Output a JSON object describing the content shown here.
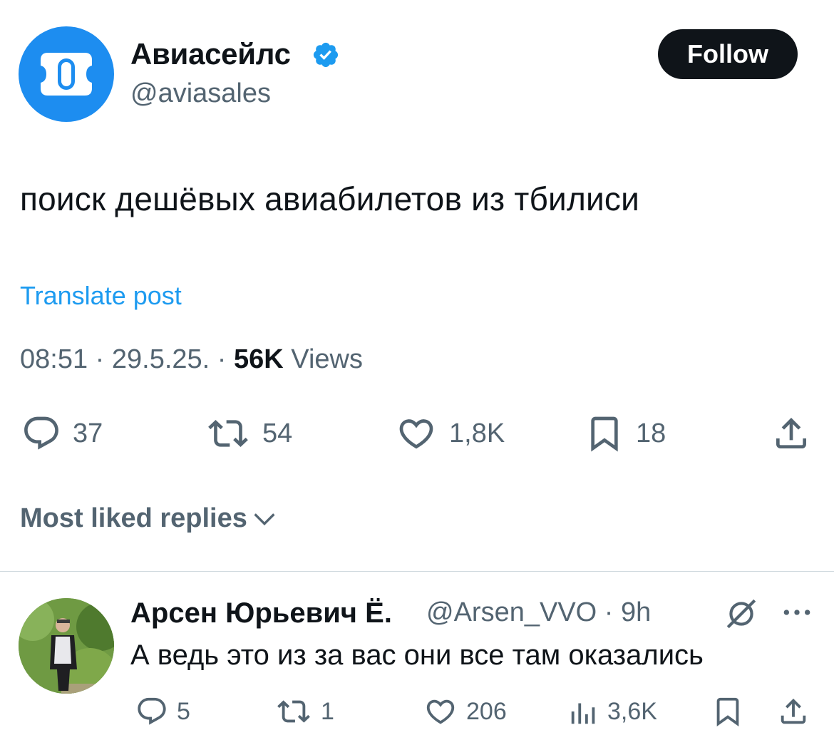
{
  "author": {
    "display_name": "Авиасейлс",
    "handle": "@aviasales",
    "brand_color": "#1d8df0",
    "verified_color": "#1d9bf0"
  },
  "follow_label": "Follow",
  "post": {
    "text": "поиск дешёвых авиабилетов из тбилиси",
    "translate_label": "Translate post",
    "time": "08:51",
    "date": "29.5.25.",
    "views_count": "56K",
    "views_label": "Views"
  },
  "actions": {
    "replies": "37",
    "reposts": "54",
    "likes": "1,8K",
    "bookmarks": "18"
  },
  "sort": {
    "label": "Most liked replies"
  },
  "reply": {
    "display_name": "Арсен Юрьевич Ё.",
    "handle": "@Arsen_VVO",
    "time": "9h",
    "text": "А ведь это из за вас они все там оказались",
    "actions": {
      "replies": "5",
      "reposts": "1",
      "likes": "206",
      "views": "3,6K"
    }
  },
  "icons": [
    "verified-badge-icon",
    "reply-icon",
    "repost-icon",
    "like-icon",
    "bookmark-icon",
    "share-icon",
    "chevron-down-icon",
    "grok-icon",
    "more-icon",
    "views-icon"
  ]
}
